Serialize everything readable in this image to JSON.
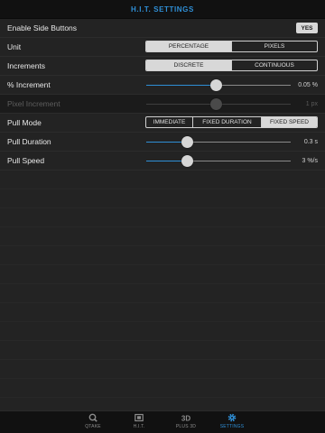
{
  "header": {
    "title": "H.I.T. SETTINGS"
  },
  "rows": {
    "side_buttons": {
      "label": "Enable Side Buttons",
      "value": "YES"
    },
    "unit": {
      "label": "Unit",
      "options": [
        "PERCENTAGE",
        "PIXELS"
      ],
      "selected": "PERCENTAGE"
    },
    "increments": {
      "label": "Increments",
      "options": [
        "DISCRETE",
        "CONTINUOUS"
      ],
      "selected": "DISCRETE"
    },
    "pct_increment": {
      "label": "% Increment",
      "value": "0.05 %",
      "level": 0.48
    },
    "pixel_increment": {
      "label": "Pixel Increment",
      "value": "1 px",
      "level": 0.48,
      "disabled": true
    },
    "pull_mode": {
      "label": "Pull Mode",
      "options": [
        "IMMEDIATE",
        "FIXED DURATION",
        "FIXED SPEED"
      ],
      "selected": "FIXED SPEED"
    },
    "pull_duration": {
      "label": "Pull Duration",
      "value": "0.3 s",
      "level": 0.28
    },
    "pull_speed": {
      "label": "Pull Speed",
      "value": "3 %/s",
      "level": 0.28
    }
  },
  "tabbar": {
    "tabs": [
      {
        "label": "QTAKE",
        "icon": "search-icon",
        "active": false
      },
      {
        "label": "H.I.T.",
        "icon": "hit-icon",
        "active": false
      },
      {
        "label": "PLUS 3D",
        "icon": "3d-icon",
        "active": false
      },
      {
        "label": "SETTINGS",
        "icon": "gear-icon",
        "active": true
      }
    ]
  },
  "colors": {
    "accent": "#2f8fd6",
    "background": "#1e1e1e",
    "bar": "#111111"
  }
}
